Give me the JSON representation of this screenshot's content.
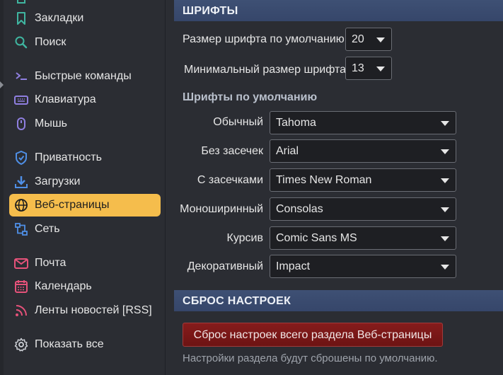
{
  "sidebar": {
    "items": [
      {
        "label": "Закладки",
        "icon": "bookmark-icon"
      },
      {
        "label": "Поиск",
        "icon": "search-icon"
      },
      {
        "label": "Быстрые команды",
        "icon": "terminal-icon"
      },
      {
        "label": "Клавиатура",
        "icon": "keyboard-icon"
      },
      {
        "label": "Мышь",
        "icon": "mouse-icon"
      },
      {
        "label": "Приватность",
        "icon": "shield-icon"
      },
      {
        "label": "Загрузки",
        "icon": "download-icon"
      },
      {
        "label": "Веб-страницы",
        "icon": "globe-icon",
        "active": true
      },
      {
        "label": "Сеть",
        "icon": "network-icon"
      },
      {
        "label": "Почта",
        "icon": "mail-icon"
      },
      {
        "label": "Календарь",
        "icon": "calendar-icon"
      },
      {
        "label": "Ленты новостей [RSS]",
        "icon": "rss-icon"
      },
      {
        "label": "Показать все",
        "icon": "gear-icon"
      }
    ]
  },
  "fonts_section": {
    "title": "ШРИФТЫ",
    "default_size_label": "Размер шрифта по умолчанию",
    "default_size_value": "20",
    "min_size_label": "Минимальный размер шрифта",
    "min_size_value": "13",
    "defaults_heading": "Шрифты по умолчанию",
    "fonts": [
      {
        "label": "Обычный",
        "value": "Tahoma"
      },
      {
        "label": "Без засечек",
        "value": "Arial"
      },
      {
        "label": "С засечками",
        "value": "Times New Roman"
      },
      {
        "label": "Моноширинный",
        "value": "Consolas"
      },
      {
        "label": "Курсив",
        "value": "Comic Sans MS"
      },
      {
        "label": "Декоративный",
        "value": "Impact"
      }
    ]
  },
  "reset_section": {
    "title": "СБРОС НАСТРОЕК",
    "button_label": "Сброс настроек всего раздела Веб-страницы",
    "note": "Настройки раздела будут сброшены по умолчанию."
  },
  "colors": {
    "accent": "#f5bd4c",
    "section_header": "#3b4c70",
    "danger_button": "#7a1717"
  }
}
